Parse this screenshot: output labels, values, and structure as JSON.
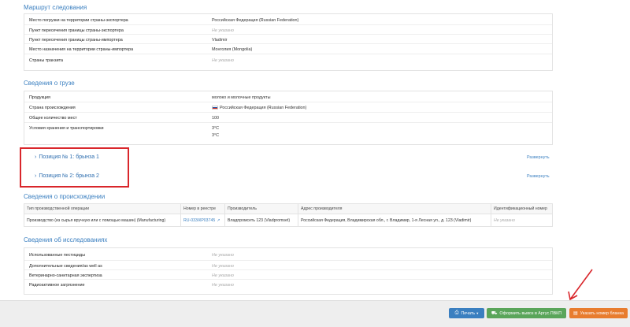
{
  "route": {
    "title": "Маршрут следования",
    "rows": [
      {
        "label": "Место погрузки на территории страны-экспортера",
        "value": "Российская Федерация (Russian Federation)",
        "muted": false
      },
      {
        "label": "Пункт пересечения границы страны-экспортера",
        "value": "Не указано",
        "muted": true
      },
      {
        "label": "Пункт пересечения границы страны-импортера",
        "value": "Vladimir",
        "muted": false
      },
      {
        "label": "Место назначения на территории страны-импортера",
        "value": "Монголия (Mongolia)",
        "muted": false
      },
      {
        "label": "Страны транзита",
        "value": "Не указано",
        "muted": true
      }
    ]
  },
  "cargo": {
    "title": "Сведения о грузе",
    "rows": [
      {
        "label": "Продукция",
        "value": "молоко и молочные продукты"
      },
      {
        "label": "Страна происхождения",
        "value": "Российская Федерация (Russian Federation)",
        "flag": true
      },
      {
        "label": "Общее количество мест",
        "value": "100"
      },
      {
        "label": "Условия хранения и транспортировки",
        "value": "3°C",
        "value2": "3°C"
      }
    ]
  },
  "positions": [
    {
      "label": "Позиция № 1: брынза 1",
      "expand": "Развернуть"
    },
    {
      "label": "Позиция № 2: брынза 2",
      "expand": "Развернуть"
    }
  ],
  "origin": {
    "title": "Сведения о происхождении",
    "headers": [
      "Тип производственной операции",
      "Номер в реестре",
      "Производитель",
      "Адрес производителя",
      "Идентификационный номер"
    ],
    "row": {
      "operation": "Производство (из сырья вручную или с помощью машин) (Manufacturing)",
      "registry": "RU-033/КР03745",
      "producer": "Владпромсеть 123 (Vladpromset)",
      "address": "Российская Федерация, Владимирская обл., г. Владимир, 1-я Лесная ул., д. 123 (Vladimir)",
      "id": "Не указано"
    }
  },
  "research": {
    "title": "Сведения об исследованиях",
    "rows": [
      {
        "label": "Использованные пестициды",
        "value": "Не указано"
      },
      {
        "label": "Дополнительные сведения/as well as",
        "value": "Не указано"
      },
      {
        "label": "Ветеринарно-санитарная экспертиза",
        "value": "Не указано"
      },
      {
        "label": "Радиоактивное загрязнение",
        "value": "Не указано"
      }
    ]
  },
  "footer": {
    "print": "Печать",
    "issue": "Оформить вывоз в Аргус.ПВКП",
    "number": "Указать номер бланка"
  },
  "colors": {
    "accent": "#3a7fc0",
    "highlight": "#d9262b",
    "print": "#3a7fc0",
    "issue": "#5aa55a",
    "number": "#e87c2e"
  }
}
